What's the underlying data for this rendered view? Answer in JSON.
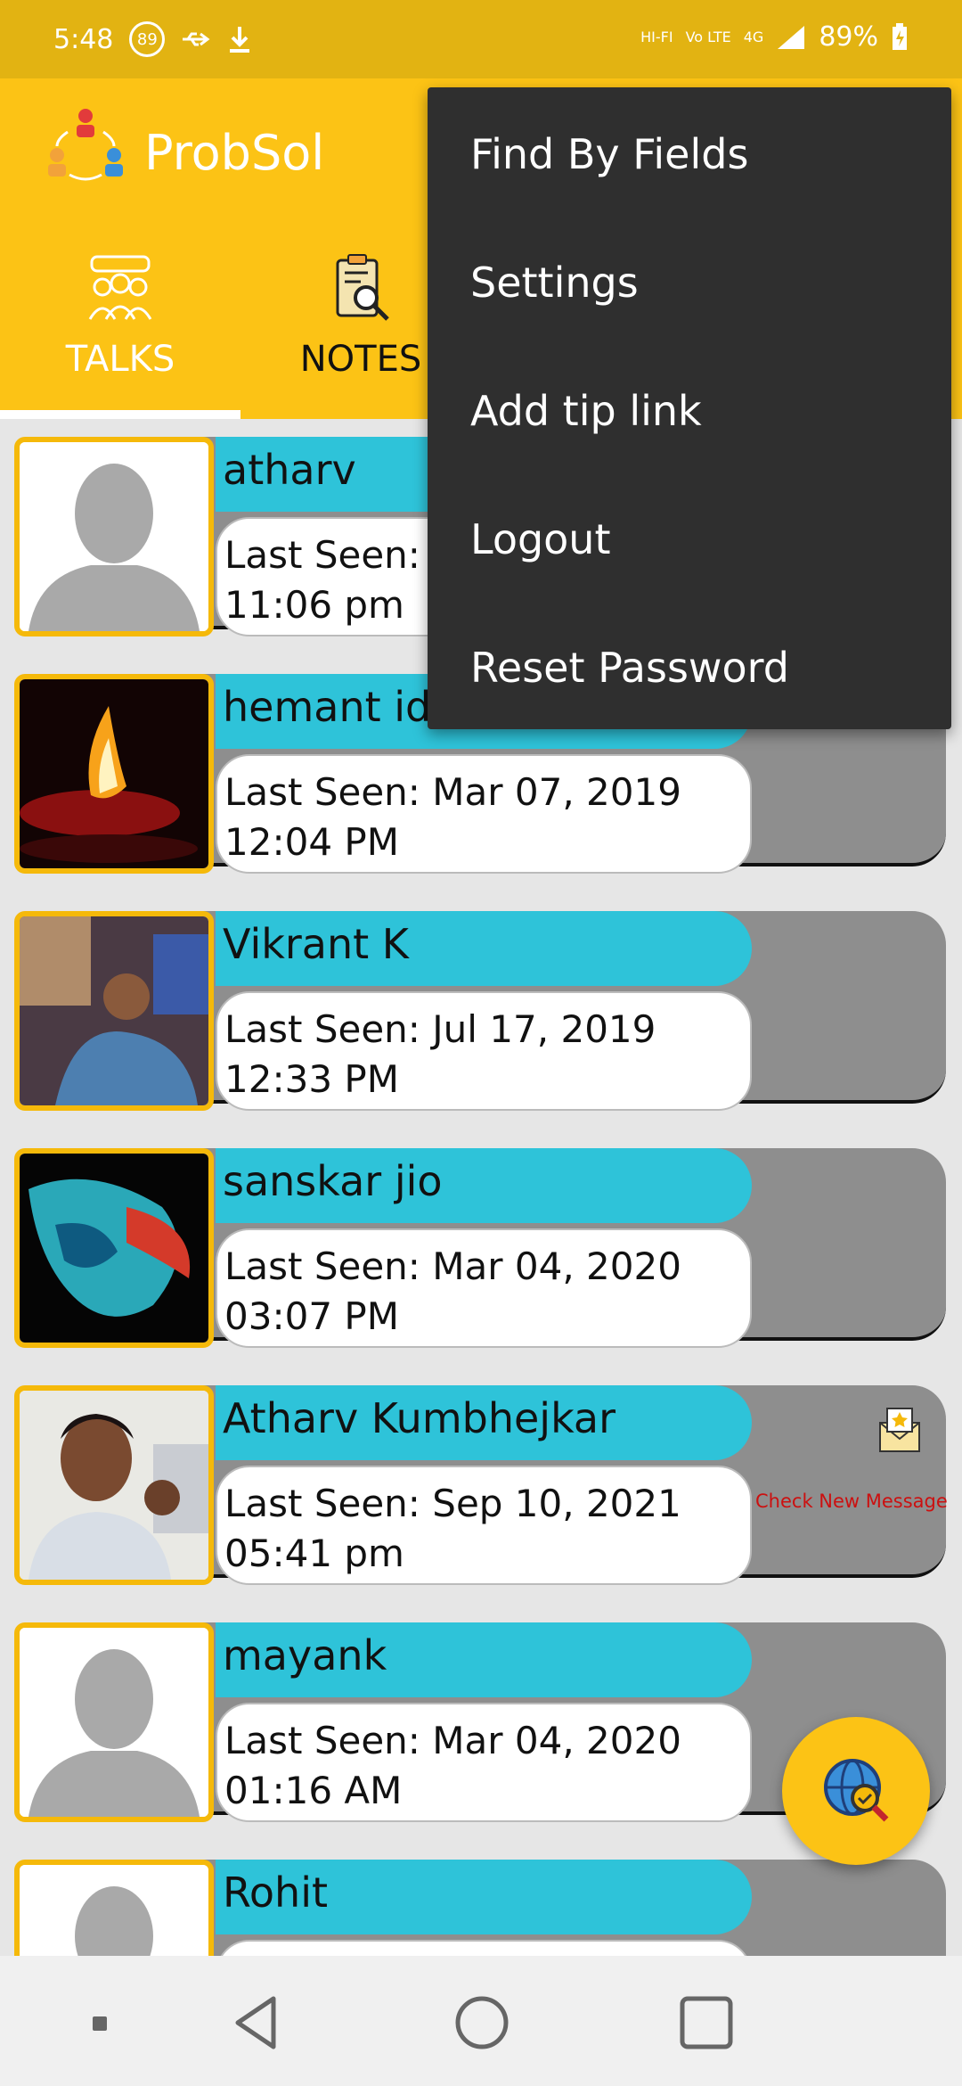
{
  "status_bar": {
    "time": "5:48",
    "notification_count": "89",
    "battery": "89%",
    "network_labels": [
      "HI-FI",
      "Vo LTE",
      "4G"
    ]
  },
  "app": {
    "title": "ProbSol"
  },
  "tabs": [
    {
      "label": "TALKS"
    },
    {
      "label": "NOTES"
    }
  ],
  "menu": {
    "items": [
      "Find By Fields",
      "Settings",
      "Add tip link",
      "Logout",
      "Reset Password"
    ]
  },
  "contacts": [
    {
      "name": "atharv",
      "seen_line1": "Last Seen: J",
      "seen_line2": "11:06 pm",
      "avatar": "default-avatar"
    },
    {
      "name": "hemant ide",
      "seen_line1": "Last Seen: Mar 07, 2019",
      "seen_line2": "12:04 PM",
      "avatar": "diya-photo"
    },
    {
      "name": "Vikrant K",
      "seen_line1": "Last Seen: Jul 17, 2019",
      "seen_line2": "12:33 PM",
      "avatar": "man-photo"
    },
    {
      "name": "sanskar jio",
      "seen_line1": "Last Seen: Mar 04, 2020",
      "seen_line2": "03:07 PM",
      "avatar": "splash-photo"
    },
    {
      "name": "Atharv Kumbhejkar",
      "seen_line1": "Last Seen: Sep 10, 2021",
      "seen_line2": "05:41 pm",
      "avatar": "selfie-photo",
      "check_new_message": "Check New Message"
    },
    {
      "name": "mayank",
      "seen_line1": "Last Seen: Mar 04, 2020",
      "seen_line2": "01:16 AM",
      "avatar": "default-avatar"
    },
    {
      "name": "Rohit",
      "seen_line1": "",
      "seen_line2": "",
      "avatar": "default-avatar"
    }
  ],
  "colors": {
    "status_bar": "#e2b312",
    "app_bar": "#fcc315",
    "name_pill": "#2ec3d9",
    "card_bg": "#8e8e8e",
    "menu_bg": "#2f2f2f",
    "check_message": "#cc1010"
  }
}
